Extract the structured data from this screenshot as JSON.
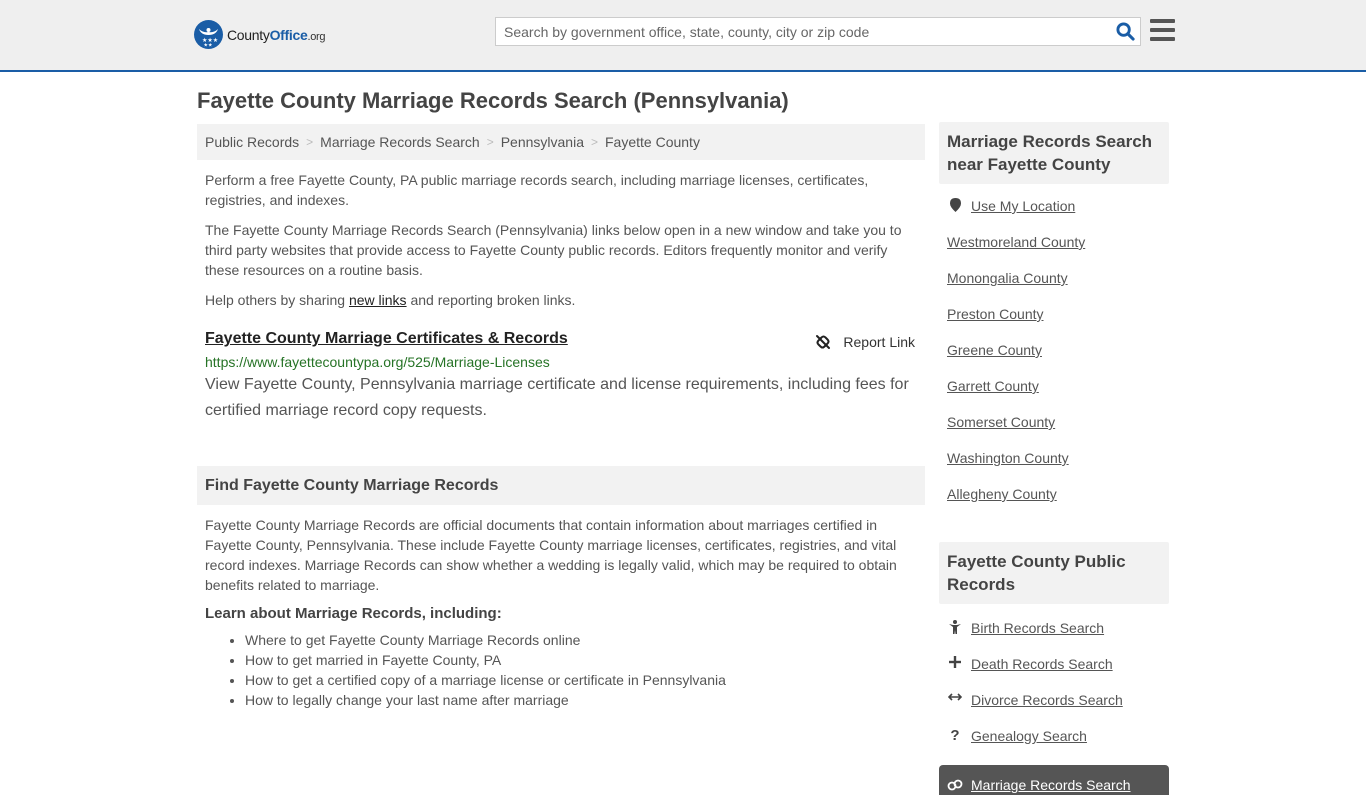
{
  "header": {
    "logo": {
      "brand_main": "County",
      "brand_accent": "Office",
      "brand_tld": ".org"
    },
    "search": {
      "placeholder": "Search by government office, state, county, city or zip code",
      "value": ""
    },
    "colors": {
      "brand": "#1a5da6",
      "header_bg": "#efefef"
    }
  },
  "page": {
    "title": "Fayette County Marriage Records Search (Pennsylvania)"
  },
  "breadcrumb": [
    {
      "label": "Public Records"
    },
    {
      "label": "Marriage Records Search"
    },
    {
      "label": "Pennsylvania"
    },
    {
      "label": "Fayette County"
    }
  ],
  "intro": {
    "p1": "Perform a free Fayette County, PA public marriage records search, including marriage licenses, certificates, registries, and indexes.",
    "p2": "The Fayette County Marriage Records Search (Pennsylvania) links below open in a new window and take you to third party websites that provide access to Fayette County public records. Editors frequently monitor and verify these resources on a routine basis.",
    "p3_before": "Help others by sharing ",
    "p3_link": "new links",
    "p3_after": " and reporting broken links."
  },
  "results": [
    {
      "title": "Fayette County Marriage Certificates & Records",
      "url": "https://www.fayettecountypa.org/525/Marriage-Licenses",
      "description": "View Fayette County, Pennsylvania marriage certificate and license requirements, including fees for certified marriage record copy requests.",
      "report_label": "Report Link"
    }
  ],
  "find_section": {
    "heading": "Find Fayette County Marriage Records",
    "body": "Fayette County Marriage Records are official documents that contain information about marriages certified in Fayette County, Pennsylvania. These include Fayette County marriage licenses, certificates, registries, and vital record indexes. Marriage Records can show whether a wedding is legally valid, which may be required to obtain benefits related to marriage.",
    "learn_heading": "Learn about Marriage Records, including:",
    "learn_items": [
      "Where to get Fayette County Marriage Records online",
      "How to get married in Fayette County, PA",
      "How to get a certified copy of a marriage license or certificate in Pennsylvania",
      "How to legally change your last name after marriage"
    ]
  },
  "sidebar": {
    "nearby_heading": "Marriage Records Search near Fayette County",
    "use_location": "Use My Location",
    "nearby": [
      "Westmoreland County",
      "Monongalia County",
      "Preston County",
      "Greene County",
      "Garrett County",
      "Somerset County",
      "Washington County",
      "Allegheny County"
    ],
    "public_heading": "Fayette County Public Records",
    "public_records": [
      {
        "label": "Birth Records Search",
        "icon": "child-icon"
      },
      {
        "label": "Death Records Search",
        "icon": "plus-icon"
      },
      {
        "label": "Divorce Records Search",
        "icon": "arrows-horizontal-icon"
      },
      {
        "label": "Genealogy Search",
        "icon": "question-icon"
      },
      {
        "label": "Marriage Records Search",
        "icon": "rings-icon",
        "active": true
      }
    ]
  }
}
